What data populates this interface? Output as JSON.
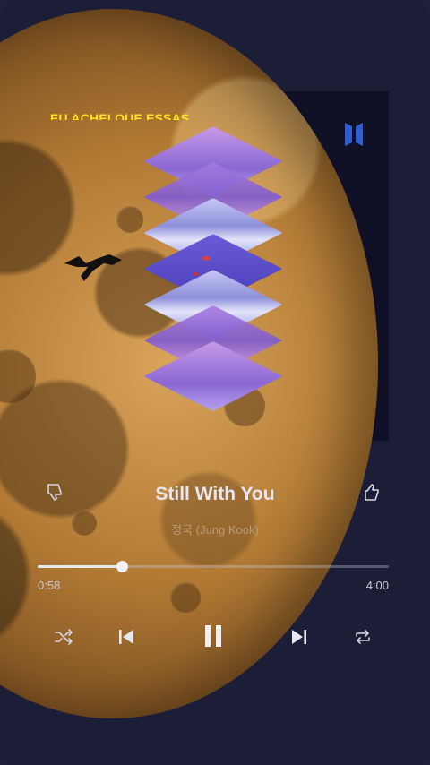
{
  "overlay": {
    "caption": "EU ACHEI QUE ESSAS"
  },
  "track": {
    "title": "Still With You",
    "artist": "정국 (Jung Kook)",
    "elapsed": "0:58",
    "duration": "4:00",
    "progress": 0.24
  },
  "actions": {
    "dislike": "thumbs-down-icon",
    "like": "thumbs-up-icon",
    "shuffle": "shuffle-icon",
    "previous": "skip-previous-icon",
    "play_pause": "pause-icon",
    "next": "skip-next-icon",
    "repeat": "repeat-icon"
  },
  "colors": {
    "accent": "#f0f0f5",
    "background": "#1e1f38",
    "caption": "#ffe21a",
    "logo": "#2f5fd6"
  }
}
